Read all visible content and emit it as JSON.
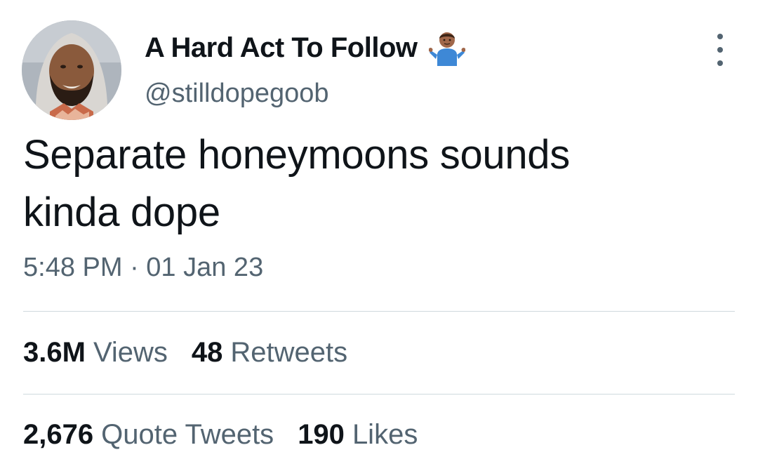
{
  "author": {
    "display_name": "A Hard Act To Follow",
    "handle": "@stilldopegoob",
    "name_emoji": "person-shrugging-emoji"
  },
  "tweet": {
    "text_line_1": "Separate honeymoons sounds",
    "text_line_2": "kinda dope",
    "timestamp": "5:48 PM · 01 Jan 23"
  },
  "stats": {
    "views": {
      "count": "3.6M",
      "label": "Views"
    },
    "retweets": {
      "count": "48",
      "label": "Retweets"
    },
    "quote_tweets": {
      "count": "2,676",
      "label": "Quote Tweets"
    },
    "likes": {
      "count": "190",
      "label": "Likes"
    }
  },
  "colors": {
    "primary_text": "#0f1419",
    "secondary_text": "#536471",
    "divider": "#cfd9de",
    "background": "#ffffff"
  },
  "icons": {
    "more": "more-options-icon"
  }
}
